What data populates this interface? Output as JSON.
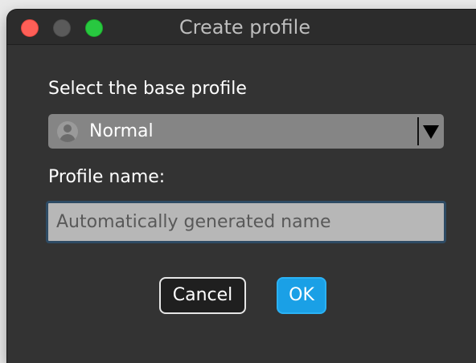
{
  "window": {
    "title": "Create profile"
  },
  "base_profile": {
    "label": "Select the base profile",
    "selected": "Normal",
    "selected_icon": "profile-avatar-icon"
  },
  "profile_name": {
    "label": "Profile name:",
    "value": "",
    "placeholder": "Automatically generated name"
  },
  "buttons": {
    "cancel_label": "Cancel",
    "ok_label": "OK"
  },
  "colors": {
    "accent": "#1aa0e6",
    "close": "#fe5f57",
    "minimize": "#5a5a5a",
    "zoom": "#28c840",
    "window_bg": "#333333"
  }
}
